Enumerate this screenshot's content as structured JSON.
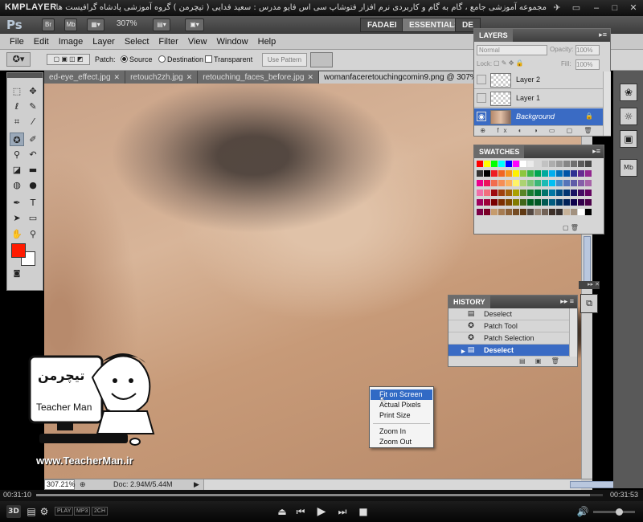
{
  "km": {
    "logo": "KMPLAYER",
    "video_title": "مجموعه آموزشی جامع ، گام به گام و کاربردی نرم افزار فتوشاپ سی اس فایو مدرس : سعید فدایی ( تیچرمن ) گروه آموزشی پادشاه گرافیست ها"
  },
  "ps": {
    "logo": "Ps",
    "appbar": {
      "br": "Br",
      "mb": "Mb",
      "zoom": "307%"
    },
    "workspaces": [
      "FADAEI",
      "ESSENTIALS",
      "DE"
    ]
  },
  "menu": [
    "File",
    "Edit",
    "Image",
    "Layer",
    "Select",
    "Filter",
    "View",
    "Window",
    "Help"
  ],
  "options": {
    "patch_label": "Patch:",
    "source": "Source",
    "destination": "Destination",
    "transparent": "Transparent",
    "use_pattern": "Use Pattern"
  },
  "tabs": [
    {
      "label": "ed-eye_effect.jpg"
    },
    {
      "label": "retouch2zh.jpg"
    },
    {
      "label": "retouching_faces_before.jpg"
    },
    {
      "label": "womanfaceretouchingcomin9.png @ 307%"
    }
  ],
  "layers": {
    "tab": "LAYERS",
    "blend_mode": "Normal",
    "opacity_label": "Opacity:",
    "opacity": "100%",
    "lock_label": "Lock:",
    "fill_label": "Fill:",
    "fill": "100%",
    "rows": [
      "Layer 2",
      "Layer 1",
      "Background"
    ]
  },
  "swatches": {
    "tab": "SWATCHES",
    "colors": [
      "#ff0000",
      "#ffff00",
      "#00ff00",
      "#00ffff",
      "#0000ff",
      "#ff00ff",
      "#ffffff",
      "#ebebeb",
      "#d6d6d6",
      "#c2c2c2",
      "#adadad",
      "#999999",
      "#858585",
      "#707070",
      "#5c5c5c",
      "#474747",
      "#333333",
      "#000000",
      "#ee1d24",
      "#f16522",
      "#f7941d",
      "#fff200",
      "#8dc63f",
      "#39b54a",
      "#00a651",
      "#00a99d",
      "#00aeef",
      "#0072bc",
      "#0054a6",
      "#2e3192",
      "#662d91",
      "#92278f",
      "#ec008c",
      "#ed145b",
      "#f26c4f",
      "#f68e55",
      "#fbaf5c",
      "#fff467",
      "#acd372",
      "#7cc576",
      "#3bb878",
      "#1abbb4",
      "#00bff3",
      "#438cca",
      "#5574b9",
      "#605ca8",
      "#855fa8",
      "#a763a8",
      "#f06ea9",
      "#f26d7d",
      "#9e0b0f",
      "#a0410d",
      "#a36209",
      "#aba000",
      "#598527",
      "#1a7b30",
      "#007236",
      "#00746b",
      "#0076a3",
      "#004b80",
      "#003471",
      "#1b1464",
      "#440e62",
      "#630460",
      "#9e005d",
      "#9e0039",
      "#790000",
      "#7b2e00",
      "#7d4900",
      "#827b00",
      "#406618",
      "#005e20",
      "#005826",
      "#005952",
      "#005b7f",
      "#003663",
      "#002157",
      "#0d004c",
      "#32004b",
      "#4b0049",
      "#7b0046",
      "#7a0026",
      "#c69c6d",
      "#a67c52",
      "#8c6239",
      "#754c24",
      "#603913",
      "#534741",
      "#998675",
      "#736357",
      "#3e3129",
      "#362f2d",
      "#c7b299",
      "#a2917f",
      "#ffffff",
      "#000000"
    ]
  },
  "history": {
    "tab": "HISTORY",
    "rows": [
      "Deselect",
      "Patch Tool",
      "Patch Selection",
      "Deselect"
    ]
  },
  "context_menu": [
    "Fit on Screen",
    "Actual Pixels",
    "Print Size",
    "Zoom In",
    "Zoom Out"
  ],
  "status": {
    "zoom": "307.21%",
    "doc": "Doc: 2.94M/5.44M"
  },
  "watermark": {
    "url": "www.TeacherMan.ir",
    "name": "Teacher Man",
    "persian": "تیچرمن"
  },
  "player": {
    "time_current": "00:31:10",
    "time_total": "00:31:53",
    "progress": 0.977,
    "badges": [
      "PLAY",
      "MP3",
      "2CH"
    ]
  },
  "colors": {
    "foreground": "#ff1a00",
    "background": "#ffffff",
    "selection": "#3a6bc4"
  }
}
